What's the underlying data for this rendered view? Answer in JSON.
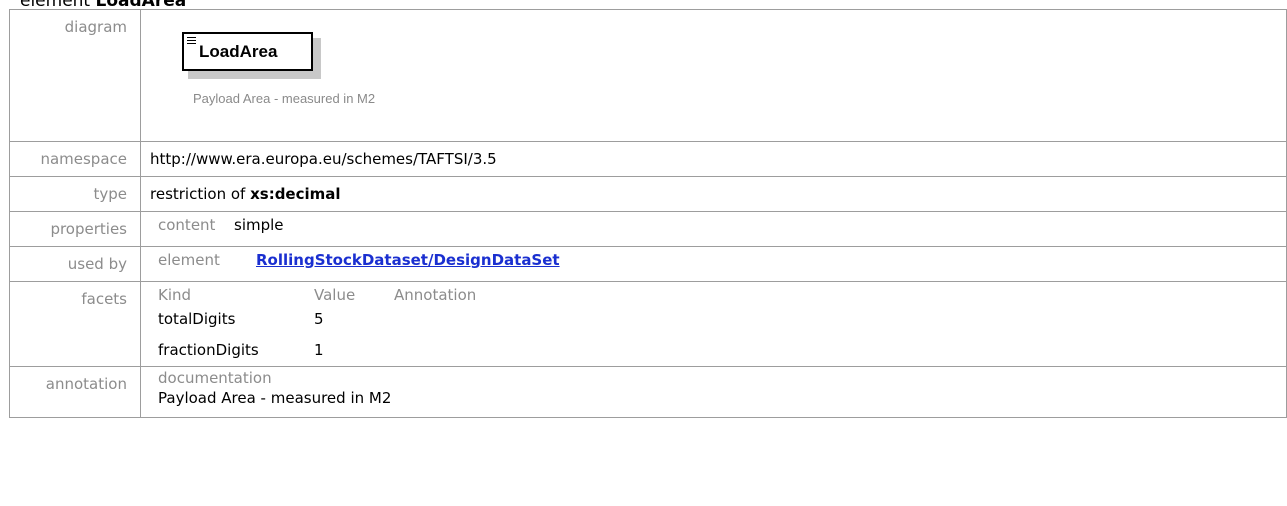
{
  "heading": {
    "prefix": "element",
    "name": "LoadArea"
  },
  "rows": {
    "diagram": {
      "label": "diagram",
      "element_name": "LoadArea",
      "element_doc": "Payload Area - measured in M2"
    },
    "namespace": {
      "label": "namespace",
      "value": "http://www.era.europa.eu/schemes/TAFTSI/3.5"
    },
    "type": {
      "label": "type",
      "prefix": "restriction of",
      "base": "xs:decimal"
    },
    "properties": {
      "label": "properties",
      "key": "content",
      "value": "simple"
    },
    "used_by": {
      "label": "used by",
      "kind": "element",
      "link": "RollingStockDataset/DesignDataSet"
    },
    "facets": {
      "label": "facets",
      "headers": [
        "Kind",
        "Value",
        "Annotation"
      ],
      "rows": [
        {
          "kind": "totalDigits",
          "value": "5",
          "annotation": ""
        },
        {
          "kind": "fractionDigits",
          "value": "1",
          "annotation": ""
        }
      ]
    },
    "annotation": {
      "label": "annotation",
      "key": "documentation",
      "text": "Payload Area - measured in M2"
    }
  },
  "colors": {
    "label": "#8c8c8c",
    "border": "#9d9d9d",
    "link": "#1a2fd0"
  }
}
